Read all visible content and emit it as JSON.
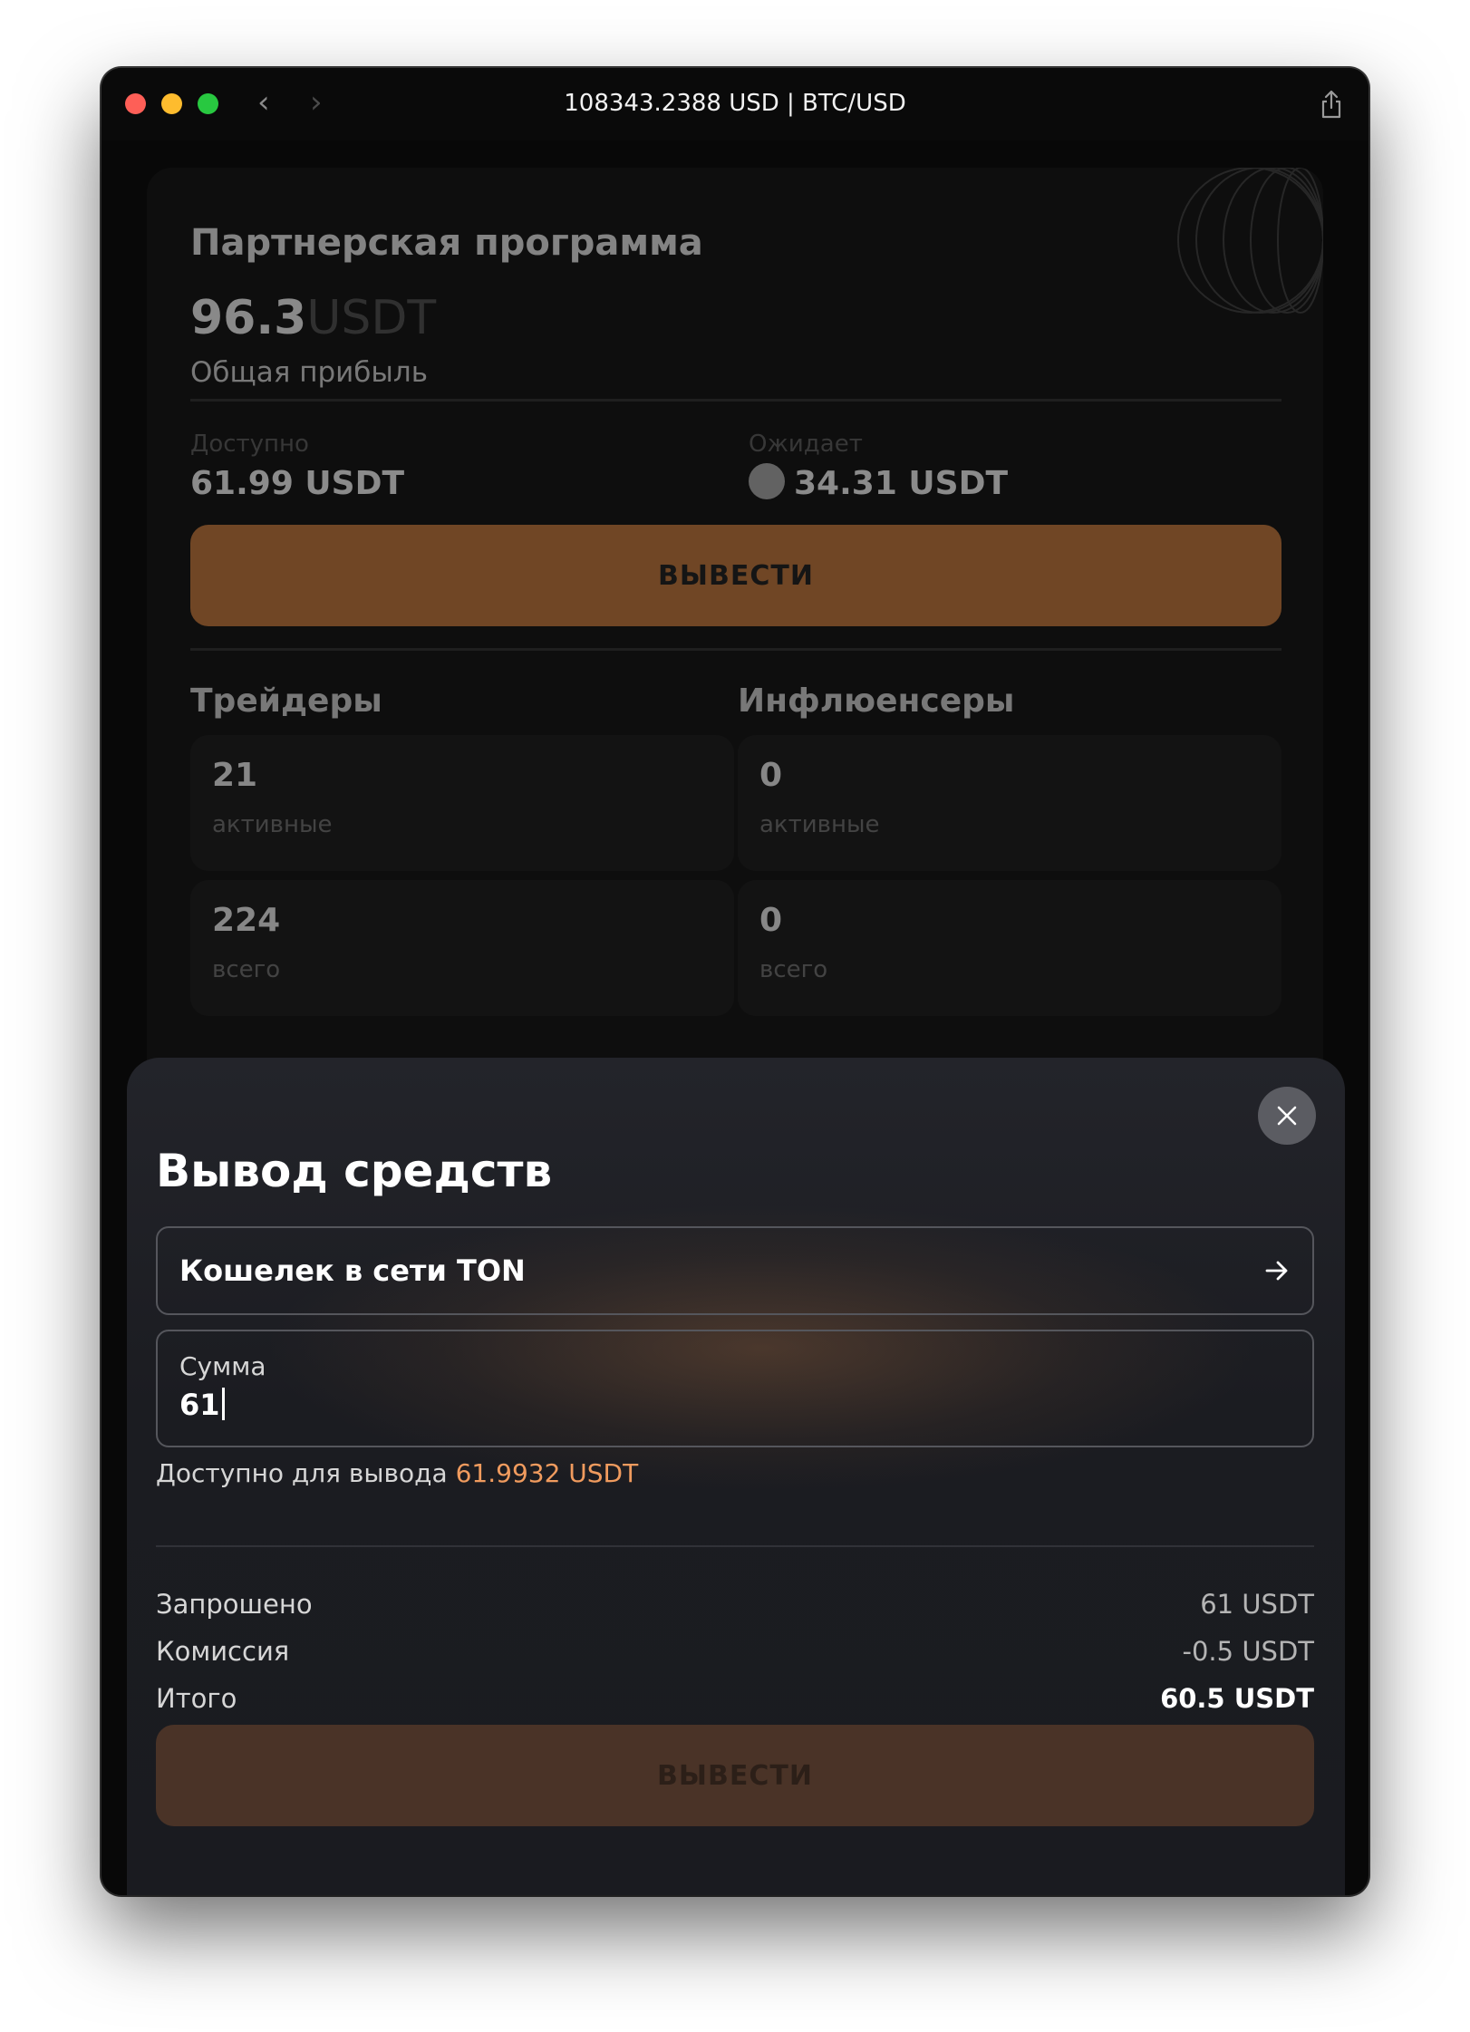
{
  "window": {
    "title": "108343.2388 USD | BTC/USD",
    "nav_back": "‹",
    "nav_forward": "›"
  },
  "partner_card": {
    "title": "Партнерская программа",
    "profit_value": "96.3",
    "profit_unit": "USDT",
    "profit_label": "Общая прибыль",
    "available_label": "Доступно",
    "available_value": "61.99 USDT",
    "pending_label": "Ожидает",
    "pending_value": "34.31 USDT",
    "withdraw_button": "ВЫВЕСТИ",
    "traders_title": "Трейдеры",
    "influencers_title": "Инфлюенсеры",
    "traders_active_count": "21",
    "traders_active_label": "активные",
    "traders_total_count": "224",
    "traders_total_label": "всего",
    "influencers_active_count": "0",
    "influencers_active_label": "активные",
    "influencers_total_count": "0",
    "influencers_total_label": "всего"
  },
  "withdraw_modal": {
    "title": "Вывод средств",
    "wallet_label": "Кошелек в сети TON",
    "amount_label": "Сумма",
    "amount_value": "61",
    "available_prefix": "Доступно для вывода",
    "available_amount": "61.9932 USDT",
    "requested_label": "Запрошено",
    "requested_value": "61 USDT",
    "fee_label": "Комиссия",
    "fee_value": "-0.5 USDT",
    "total_label": "Итого",
    "total_value": "60.5 USDT",
    "submit_button": "ВЫВЕСТИ"
  },
  "icons": {
    "close": "close-icon",
    "arrow": "arrow-right-icon",
    "share": "share-icon",
    "clock": "clock-icon"
  },
  "colors": {
    "accent": "#b06c37",
    "available_amount": "#f09b5e",
    "background": "#080808"
  }
}
